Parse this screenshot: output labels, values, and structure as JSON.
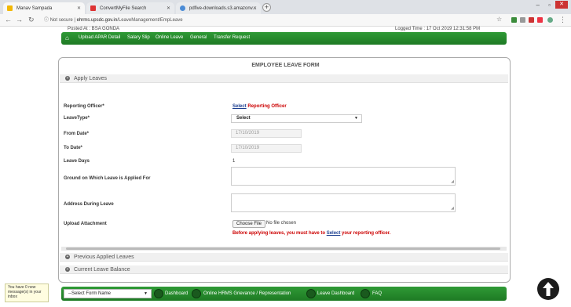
{
  "browser": {
    "tabs": [
      {
        "title": "Manav Sampada",
        "active": true
      },
      {
        "title": "ConvertMyFile Search",
        "active": false
      },
      {
        "title": "pdfive-downloads.s3.amazonv...",
        "active": false
      }
    ],
    "url_prefix": "Not secure",
    "url_host": "ehrms.upsdc.gov.in",
    "url_path": "/LeaveManagement/EmpLeave",
    "colors": {
      "tab_fav_1": "#f2b705",
      "tab_fav_2": "#d33",
      "tab_fav_3": "#4a8bd6"
    }
  },
  "header": {
    "posted_at": "Posted At : BSA GONDA",
    "logged_time": "Logged Time : 17 Oct 2019 12:31:58 PM"
  },
  "nav": {
    "items": [
      "Upload APAR Detail",
      "Salary Slip",
      "Online Leave",
      "General",
      "Transfer Request"
    ],
    "color": "#2a8f30"
  },
  "form": {
    "title": "EMPLOYEE LEAVE FORM",
    "apply_section": "Apply Leaves",
    "reporting_officer_label": "Reporting Officer*",
    "reporting_officer_link": "Select",
    "reporting_officer_text": " Reporting Officer",
    "leave_type_label": "LeaveType*",
    "leave_type_value": "Select",
    "from_date_label": "From Date*",
    "from_date_value": "17/10/2019",
    "to_date_label": "To Date*",
    "to_date_value": "17/10/2019",
    "leave_days_label": "Leave Days",
    "leave_days_value": "1",
    "ground_label": "Ground on Which Leave is Applied For",
    "address_label": "Address During Leave",
    "upload_label": "Upload Attachment",
    "choose_file": "Choose File",
    "no_file": "No file chosen",
    "warning_prefix": "Before applying leaves, you must have to ",
    "warning_link": "Select",
    "warning_suffix": " your reporting officer.",
    "previous_section": "Previous Applied Leaves",
    "balance_section": "Current Leave Balance"
  },
  "footer": {
    "notice": "You have 0 new message(s) in your inbox",
    "form_select": "--Select Form Name",
    "links": [
      "Dashboard",
      "Online HRMS Grievance / Representation",
      "Leave Dashboard",
      "FAQ"
    ]
  }
}
